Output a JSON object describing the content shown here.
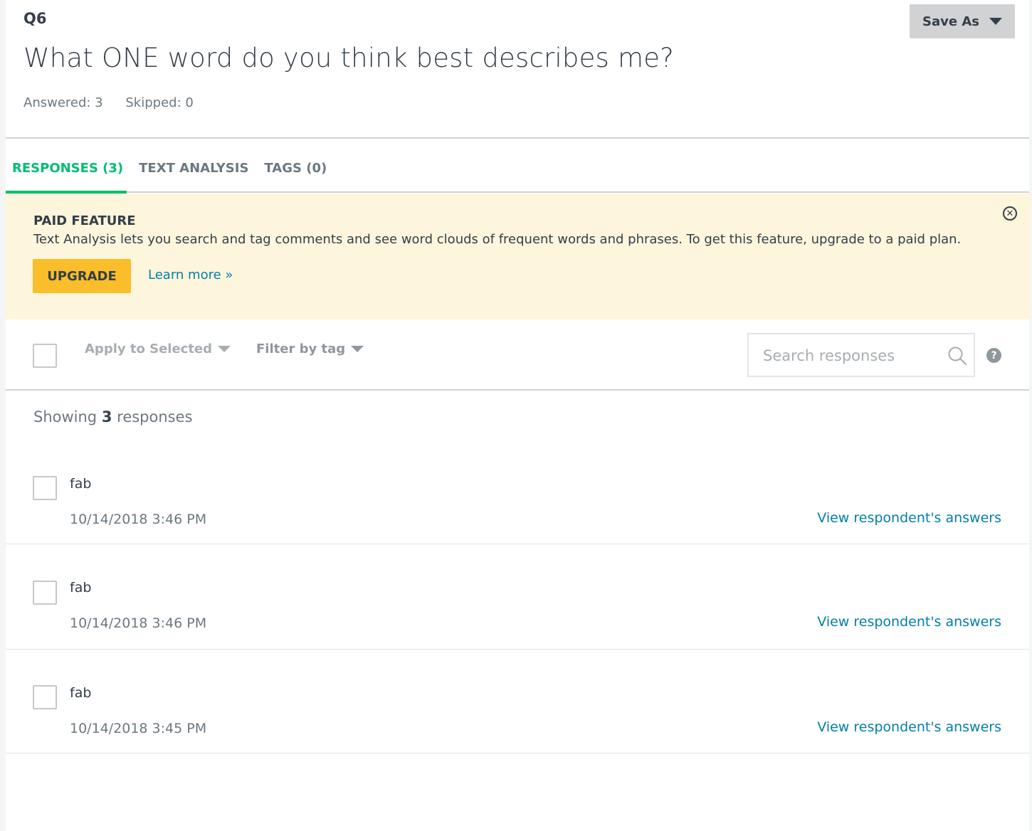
{
  "question": {
    "number": "Q6",
    "title": "What ONE word do you think best describes me?",
    "answered": "Answered: 3",
    "skipped": "Skipped: 0",
    "save_as_label": "Save As"
  },
  "tabs": [
    {
      "label": "RESPONSES (3)",
      "active": true
    },
    {
      "label": "TEXT ANALYSIS",
      "active": false
    },
    {
      "label": "TAGS (0)",
      "active": false
    }
  ],
  "banner": {
    "title": "PAID FEATURE",
    "text": "Text Analysis lets you search and tag comments and see word clouds of frequent words and phrases. To get this feature, upgrade to a paid plan.",
    "upgrade_label": "UPGRADE",
    "learn_more_label": "Learn more »",
    "close_icon": "close-circle-icon"
  },
  "toolbar": {
    "apply_label": "Apply to Selected",
    "filter_label": "Filter by tag",
    "search_placeholder": "Search responses",
    "help_label": "?"
  },
  "summary": {
    "prefix": "Showing",
    "count": "3",
    "suffix": "responses"
  },
  "responses": [
    {
      "text": "fab",
      "date": "10/14/2018 3:46 PM",
      "link": "View respondent's answers"
    },
    {
      "text": "fab",
      "date": "10/14/2018 3:46 PM",
      "link": "View respondent's answers"
    },
    {
      "text": "fab",
      "date": "10/14/2018 3:45 PM",
      "link": "View respondent's answers"
    }
  ],
  "colors": {
    "accent_green": "#00bf6f",
    "link_blue": "#007faa",
    "upgrade_yellow": "#f9be2a",
    "banner_bg": "#fdf6dc"
  }
}
